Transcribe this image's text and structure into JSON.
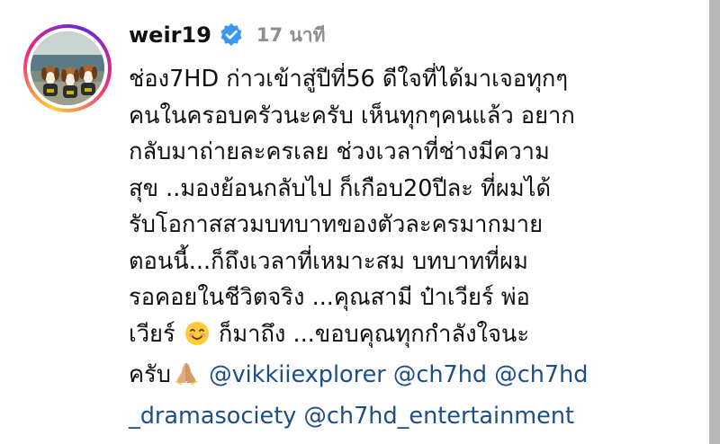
{
  "post": {
    "username": "weir19",
    "time": "17 นาที",
    "caption_lines": [
      "ช่อง7HD ก่าวเข้าสู่ปีที่56 ดีใจที่ได้มาเจอทุกๆ",
      "คนในครอบครัวนะครับ เห็นทุกๆคนแล้ว อยาก",
      "กลับมาถ่ายละครเลย ช่วงเวลาที่ช่างมีความ",
      "สุข ..มองย้อนกลับไป ก็เกือบ20ปีละ ที่ผมได้",
      "รับโอกาสสวมบทบาทของตัวละครมากมาย",
      "ตอนนี้...ก็ถึงเวลาที่เหมาะสม บทบาทที่ผม",
      "รอคอยในชีวิตจริง ...คุณสามี ป๋าเวียร์ พ่อ"
    ],
    "line8_pre": "เวียร์",
    "line8_post": "ก็มาถึง ...ขอบคุณทุกกำลังใจนะ",
    "line9_pre": "ครับ",
    "mentions": [
      "@vikkiiexplorer",
      "@ch7hd",
      "@ch7hd",
      "_dramasociety",
      "@ch7hd_entertainment"
    ]
  },
  "icons": {
    "verified": "verified-badge-icon",
    "smile_emoji": "smiling-face-emoji",
    "pray_emoji": "folded-hands-emoji"
  },
  "colors": {
    "verified": "#3897f0",
    "mention": "#1d4e89",
    "time": "#8e8e8e"
  }
}
